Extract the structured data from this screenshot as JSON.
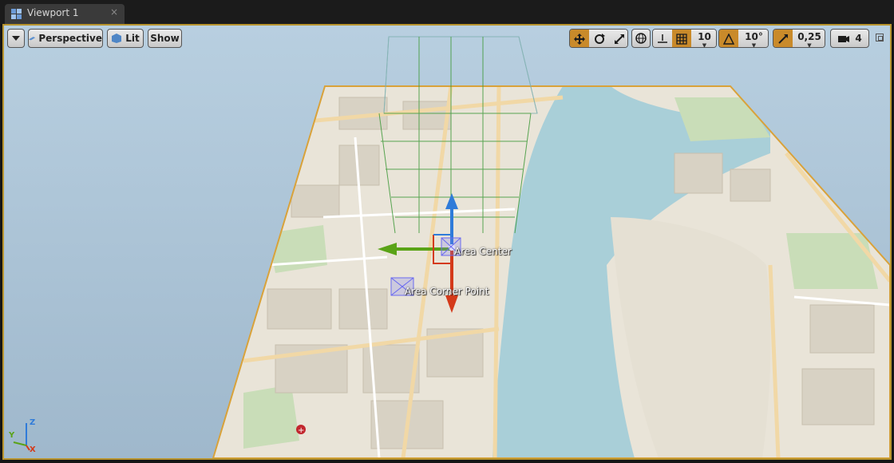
{
  "tab": {
    "title": "Viewport 1",
    "close_glyph": "×",
    "icon": "viewport-grid-icon"
  },
  "toolbar": {
    "menu_icon": "dropdown-triangle-icon",
    "perspective_label": "Perspective",
    "lit_label": "Lit",
    "show_label": "Show",
    "grid_snap_value": "10",
    "rotation_snap_value": "10°",
    "scale_snap_value": "0,25",
    "camera_speed_value": "4",
    "maximize_icon": "restore-icon"
  },
  "scene": {
    "area_center_label": "Area Center",
    "area_corner_label": "Area Corner Point",
    "axis_z": "Z",
    "axis_y": "Y",
    "axis_x": "X"
  },
  "colors": {
    "accent": "#c98a2a",
    "selection_outline": "#d9a23a",
    "water": "#a9cfd8",
    "land": "#e9e4d8",
    "park": "#c9ddb8",
    "gizmo_x": "#d43a1a",
    "gizmo_y": "#5aa317",
    "gizmo_z": "#2f7bd9"
  }
}
